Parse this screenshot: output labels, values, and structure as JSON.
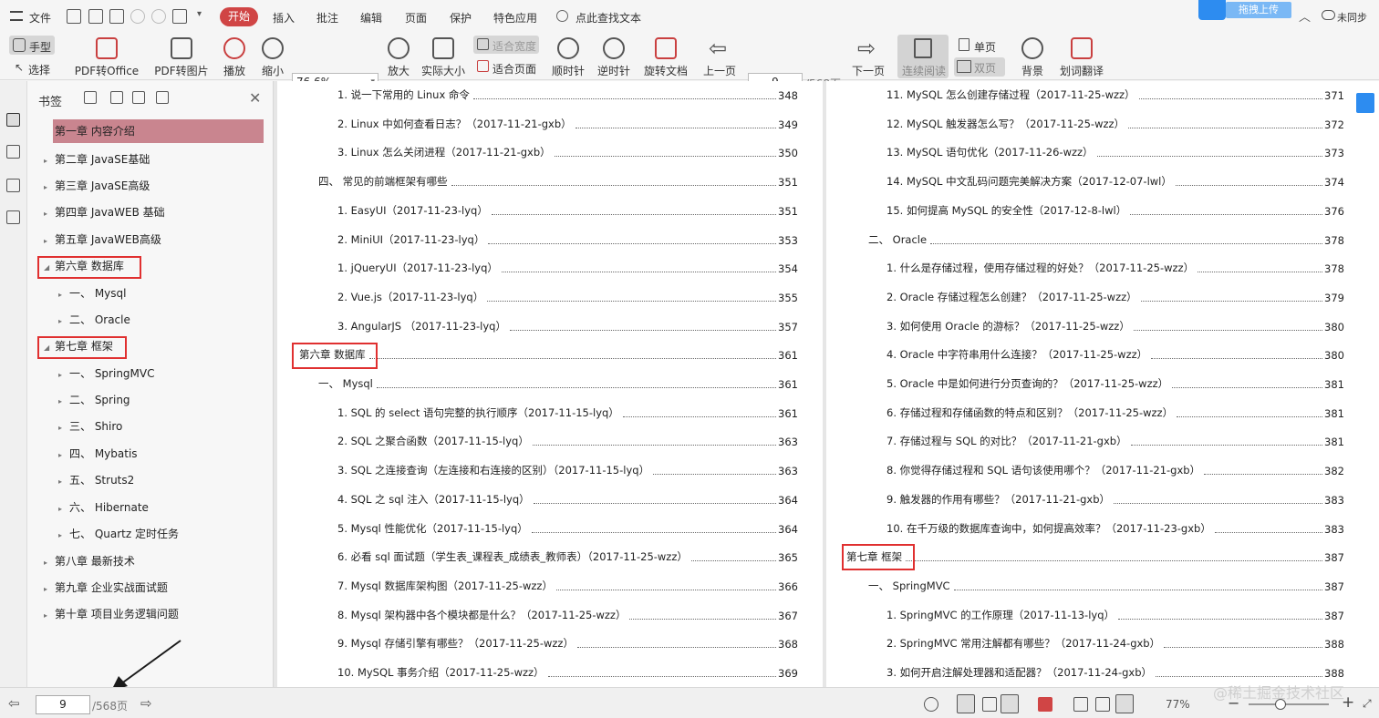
{
  "menu": {
    "file": "文件",
    "tabs": [
      "开始",
      "插入",
      "批注",
      "编辑",
      "页面",
      "保护",
      "特色应用"
    ],
    "search": "点此查找文本",
    "upload": "拖拽上传",
    "login": "未同步"
  },
  "ribbon": {
    "hand": "手型",
    "select": "选择",
    "pdf_office": "PDF转Office",
    "pdf_img": "PDF转图片",
    "play": "播放",
    "zoom_out": "缩小",
    "zoom_value": "76.6%",
    "zoom_in": "放大",
    "actual": "实际大小",
    "fit_width": "适合宽度",
    "fit_page": "适合页面",
    "cw": "顺时针",
    "ccw": "逆时针",
    "rotate": "旋转文档",
    "prev": "上一页",
    "page_value": "9",
    "page_total": "/568页",
    "next": "下一页",
    "continuous": "连续阅读",
    "single": "单页",
    "double": "双页",
    "bg": "背景",
    "translate": "划词翻译"
  },
  "sidebar": {
    "title": "书签",
    "items": [
      {
        "label": "第一章  内容介绍"
      },
      {
        "label": "第二章  JavaSE基础"
      },
      {
        "label": "第三章  JavaSE高级"
      },
      {
        "label": "第四章  JavaWEB 基础"
      },
      {
        "label": "第五章  JavaWEB高级"
      },
      {
        "label": "第六章  数据库"
      },
      {
        "label": "一、  Mysql"
      },
      {
        "label": "二、  Oracle"
      },
      {
        "label": "第七章  框架"
      },
      {
        "label": "一、  SpringMVC"
      },
      {
        "label": "二、  Spring"
      },
      {
        "label": "三、  Shiro"
      },
      {
        "label": "四、  Mybatis"
      },
      {
        "label": "五、  Struts2"
      },
      {
        "label": "六、  Hibernate"
      },
      {
        "label": "七、  Quartz 定时任务"
      },
      {
        "label": "第八章  最新技术"
      },
      {
        "label": "第九章  企业实战面试题"
      },
      {
        "label": "第十章  项目业务逻辑问题"
      }
    ]
  },
  "left_page": [
    {
      "text": "1. 说一下常用的 Linux 命令",
      "page": "348"
    },
    {
      "text": "2. Linux 中如何查看日志？（2017-11-21-gxb）",
      "page": "349"
    },
    {
      "text": "3. Linux 怎么关闭进程（2017-11-21-gxb）",
      "page": "350"
    },
    {
      "text": "四、  常见的前端框架有哪些",
      "page": "351"
    },
    {
      "text": "1. EasyUI（2017-11-23-lyq）",
      "page": "351"
    },
    {
      "text": "2. MiniUI（2017-11-23-lyq）",
      "page": "353"
    },
    {
      "text": "1. jQueryUI（2017-11-23-lyq）",
      "page": "354"
    },
    {
      "text": "2. Vue.js（2017-11-23-lyq）",
      "page": "355"
    },
    {
      "text": "3. AngularJS  （2017-11-23-lyq）",
      "page": "357"
    },
    {
      "text": "第六章  数据库",
      "page": "361"
    },
    {
      "text": "一、  Mysql",
      "page": "361"
    },
    {
      "text": "1. SQL 的 select 语句完整的执行顺序（2017-11-15-lyq）",
      "page": "361"
    },
    {
      "text": "2. SQL 之聚合函数（2017-11-15-lyq）",
      "page": "363"
    },
    {
      "text": "3. SQL 之连接查询（左连接和右连接的区别）（2017-11-15-lyq）",
      "page": "363"
    },
    {
      "text": "4. SQL 之 sql 注入（2017-11-15-lyq）",
      "page": "364"
    },
    {
      "text": "5. Mysql 性能优化（2017-11-15-lyq）",
      "page": "364"
    },
    {
      "text": "6. 必看 sql 面试题（学生表_课程表_成绩表_教师表）（2017-11-25-wzz）",
      "page": "365"
    },
    {
      "text": "7. Mysql 数据库架构图（2017-11-25-wzz）",
      "page": "366"
    },
    {
      "text": "8. Mysql 架构器中各个模块都是什么？（2017-11-25-wzz）",
      "page": "367"
    },
    {
      "text": "9. Mysql 存储引擎有哪些？（2017-11-25-wzz）",
      "page": "368"
    },
    {
      "text": "10. MySQL 事务介绍（2017-11-25-wzz）",
      "page": "369"
    }
  ],
  "right_page": [
    {
      "text": "11. MySQL 怎么创建存储过程（2017-11-25-wzz）",
      "page": "371"
    },
    {
      "text": "12. MySQL 触发器怎么写？（2017-11-25-wzz）",
      "page": "372"
    },
    {
      "text": "13. MySQL 语句优化（2017-11-26-wzz）",
      "page": "373"
    },
    {
      "text": "14. MySQL 中文乱码问题完美解决方案（2017-12-07-lwl）",
      "page": "374"
    },
    {
      "text": "15. 如何提高 MySQL 的安全性（2017-12-8-lwl）",
      "page": "376"
    },
    {
      "text": "二、  Oracle",
      "page": "378"
    },
    {
      "text": "1. 什么是存储过程，使用存储过程的好处？（2017-11-25-wzz）",
      "page": "378"
    },
    {
      "text": "2. Oracle 存储过程怎么创建？（2017-11-25-wzz）",
      "page": "379"
    },
    {
      "text": "3. 如何使用 Oracle 的游标？（2017-11-25-wzz）",
      "page": "380"
    },
    {
      "text": "4. Oracle 中字符串用什么连接？（2017-11-25-wzz）",
      "page": "380"
    },
    {
      "text": "5. Oracle 中是如何进行分页查询的？（2017-11-25-wzz）",
      "page": "381"
    },
    {
      "text": "6. 存储过程和存储函数的特点和区别？（2017-11-25-wzz）",
      "page": "381"
    },
    {
      "text": "7. 存储过程与 SQL 的对比？（2017-11-21-gxb）",
      "page": "381"
    },
    {
      "text": "8. 你觉得存储过程和 SQL 语句该使用哪个？（2017-11-21-gxb）",
      "page": "382"
    },
    {
      "text": "9. 触发器的作用有哪些？（2017-11-21-gxb）",
      "page": "383"
    },
    {
      "text": "10. 在千万级的数据库查询中，如何提高效率？（2017-11-23-gxb）",
      "page": "383"
    },
    {
      "text": "第七章  框架",
      "page": "387"
    },
    {
      "text": "一、  SpringMVC",
      "page": "387"
    },
    {
      "text": "1. SpringMVC 的工作原理（2017-11-13-lyq）",
      "page": "387"
    },
    {
      "text": "2. SpringMVC 常用注解都有哪些？（2017-11-24-gxb）",
      "page": "388"
    },
    {
      "text": "3. 如何开启注解处理器和适配器？（2017-11-24-gxb）",
      "page": "388"
    }
  ],
  "status": {
    "page_value": "9",
    "page_total": "/568页",
    "zoom": "77%",
    "watermark": "@稀土掘金技术社区"
  }
}
